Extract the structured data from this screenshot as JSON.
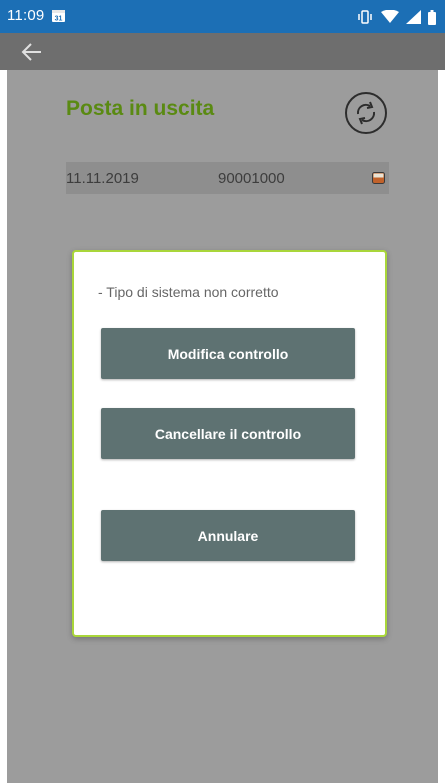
{
  "status_bar": {
    "time": "11:09",
    "calendar_day": "31"
  },
  "toolbar": {
    "back_icon": "arrow-left-icon"
  },
  "screen": {
    "title": "Posta in uscita",
    "sync_icon": "sync-icon",
    "row": {
      "date": "11.11.2019",
      "number": "90001000",
      "flag_icon": "battery-flag-icon"
    }
  },
  "dialog": {
    "message": "- Tipo di sistema non corretto",
    "buttons": [
      {
        "label": "Modifica controllo"
      },
      {
        "label": "Cancellare il controllo"
      },
      {
        "label": "Annulare"
      }
    ]
  },
  "colors": {
    "status_bar": "#1c6fb5",
    "title_green": "#5a8a12",
    "dialog_border": "#a9d63a",
    "button_bg": "#5e7272"
  }
}
